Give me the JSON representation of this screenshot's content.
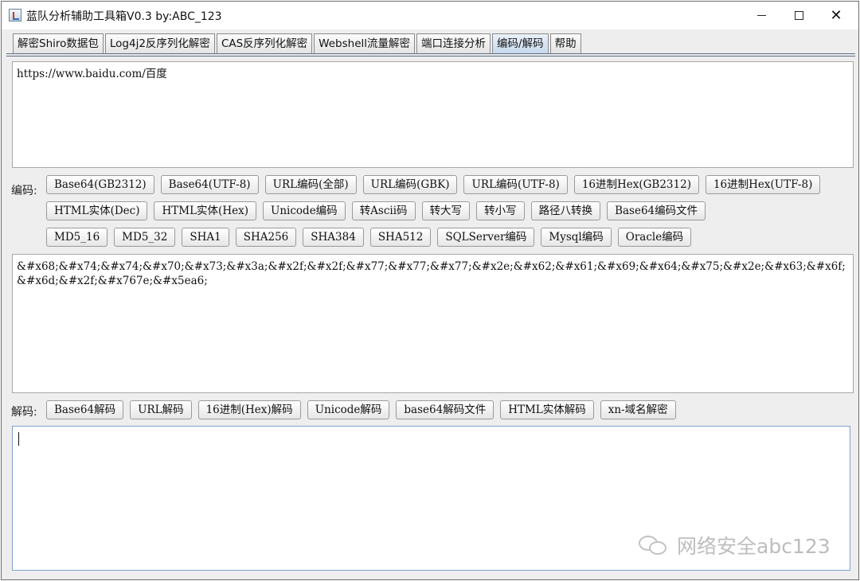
{
  "window": {
    "title": "蓝队分析辅助工具箱V0.3 by:ABC_123"
  },
  "tabs": [
    {
      "label": "解密Shiro数据包"
    },
    {
      "label": "Log4j2反序列化解密"
    },
    {
      "label": "CAS反序列化解密"
    },
    {
      "label": "Webshell流量解密"
    },
    {
      "label": "端口连接分析"
    },
    {
      "label": "编码/解码",
      "active": true
    },
    {
      "label": "帮助"
    }
  ],
  "input": {
    "value": "https://www.baidu.com/百度"
  },
  "encode": {
    "label": "编码:",
    "row1": [
      "Base64(GB2312)",
      "Base64(UTF-8)",
      "URL编码(全部)",
      "URL编码(GBK)",
      "URL编码(UTF-8)",
      "16进制Hex(GB2312)",
      "16进制Hex(UTF-8)"
    ],
    "row2": [
      "HTML实体(Dec)",
      "HTML实体(Hex)",
      "Unicode编码",
      "转Ascii码",
      "转大写",
      "转小写",
      "路径八转换",
      "Base64编码文件"
    ],
    "row3": [
      "MD5_16",
      "MD5_32",
      "SHA1",
      "SHA256",
      "SHA384",
      "SHA512",
      "SQLServer编码",
      "Mysql编码",
      "Oracle编码"
    ]
  },
  "encoded_output": {
    "value": "&#x68;&#x74;&#x74;&#x70;&#x73;&#x3a;&#x2f;&#x2f;&#x77;&#x77;&#x77;&#x2e;&#x62;&#x61;&#x69;&#x64;&#x75;&#x2e;&#x63;&#x6f;&#x6d;&#x2f;&#x767e;&#x5ea6;"
  },
  "decode": {
    "label": "解码:",
    "buttons": [
      "Base64解码",
      "URL解码",
      "16进制(Hex)解码",
      "Unicode解码",
      "base64解码文件",
      "HTML实体解码",
      "xn-域名解密"
    ]
  },
  "decoded_output": {
    "value": ""
  },
  "watermark": {
    "text": "网络安全abc123",
    "icon": "wechat-icon"
  }
}
